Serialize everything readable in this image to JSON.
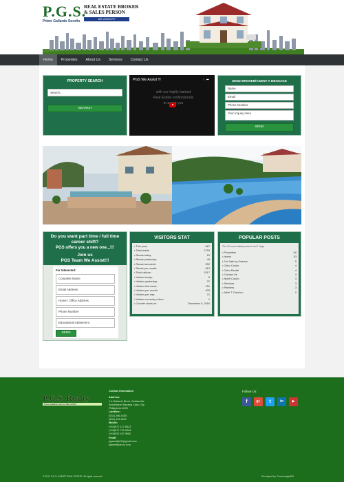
{
  "header": {
    "logo_main": "P.G.S.",
    "logo_sub": "Prime Gallardo Soroño",
    "broker_text": "REAL ESTATE BROKER & SALES PERSON",
    "tagline": "WE ASSIST!!!"
  },
  "nav": {
    "items": [
      {
        "label": "Home"
      },
      {
        "label": "Properties"
      },
      {
        "label": "About Us"
      },
      {
        "label": "Services"
      },
      {
        "label": "Contact Us"
      }
    ]
  },
  "property_search": {
    "title": "PROPERTY SEARCH",
    "placeholder": "Search...",
    "button": "SEARCH"
  },
  "video": {
    "title": "PGS We Assist !!!",
    "overlay_text": "with our highly trained Real Estate professionals to assist you"
  },
  "message_form": {
    "title": "SEND BROKER/AGENT A MESSAGE",
    "name_placeholder": "Name",
    "email_placeholder": "Email",
    "phone_placeholder": "Phone Number",
    "inquiry_placeholder": "Your Inquiry Here",
    "send_button": "SEND"
  },
  "career": {
    "question": "Do you want part time / full time career shift?",
    "offer": "PGS offers you a new one...!!!",
    "join": "Join us",
    "team": "PGS Team We Assist!!!",
    "interested_label": "For Interested:",
    "fields": [
      "Complete Name",
      "Email Address",
      "Home / Office Address",
      "Phone Number",
      "Educational Attainment"
    ],
    "send_button": "SEND"
  },
  "visitors_stat": {
    "title": "VISITORS STAT",
    "rows": [
      {
        "label": "This post:",
        "value": "667"
      },
      {
        "label": "Total reads:",
        "value": "2799"
      },
      {
        "label": "Reads today:",
        "value": "15"
      },
      {
        "label": "Reads yesterday:",
        "value": "49"
      },
      {
        "label": "Reads last week:",
        "value": "252"
      },
      {
        "label": "Reads per month:",
        "value": "613"
      },
      {
        "label": "Total visitors:",
        "value": "1517"
      },
      {
        "label": "Visitors today:",
        "value": "6"
      },
      {
        "label": "Visitors yesterday:",
        "value": "37"
      },
      {
        "label": "Visitors last week:",
        "value": "151"
      },
      {
        "label": "Visitors per month:",
        "value": "403"
      },
      {
        "label": "Visitors per day:",
        "value": "21"
      },
      {
        "label": "Visitors currently online:",
        "value": "1"
      },
      {
        "label": "Counter starts on:",
        "value": "December 6, 2016"
      }
    ]
  },
  "popular_posts": {
    "title": "POPULAR POSTS",
    "subtitle": "The 10 most visited posts in last 7 days.",
    "rows": [
      {
        "label": "Properties",
        "value": "60"
      },
      {
        "label": "Home",
        "value": "53"
      },
      {
        "label": "For Sale by Owners",
        "value": "5"
      },
      {
        "label": "Cebu Condo",
        "value": "4"
      },
      {
        "label": "Cebu Rental",
        "value": "4"
      },
      {
        "label": "Contact Us",
        "value": "4"
      },
      {
        "label": "North Condo",
        "value": "3"
      },
      {
        "label": "Services",
        "value": "3"
      },
      {
        "label": "Partners",
        "value": "3"
      },
      {
        "label": "Adile T. Daculan",
        "value": "2"
      }
    ]
  },
  "footer": {
    "logo": "P.G.S. Realty",
    "logo_sub": "Prime Gallardo Soroño   WE ASSIST",
    "contact_title": "Contact Information",
    "address_label": "Address:",
    "address": [
      "J.A Gallardo Block, Soldanville",
      "Subdivision Banawa Cebu City",
      "Philippines 6000"
    ],
    "landline_label": "Landline:",
    "landline": [
      "(032) 266-4355",
      "(032) 414-4621"
    ],
    "mobile_label": "Mobile:",
    "mobile": [
      "(+63)917 127 6612",
      "(+63)917 715 3944",
      "(+63)932 167 9962"
    ],
    "email_label": "Email:",
    "email": [
      "pgsrealty01@gmail.com",
      "pgsre@yahoo.com"
    ],
    "follow_label": "Follow Us:",
    "copyright": "© 2017 P.G.S. ASSIST REAL ESTATE. All rights reserved",
    "developer": "Developed by: FocusImage360"
  },
  "colors": {
    "brand_green": "#1f6f4a",
    "button_green": "#28923e",
    "footer_green": "#1c6e1d",
    "nav_dark": "#2e3436"
  }
}
